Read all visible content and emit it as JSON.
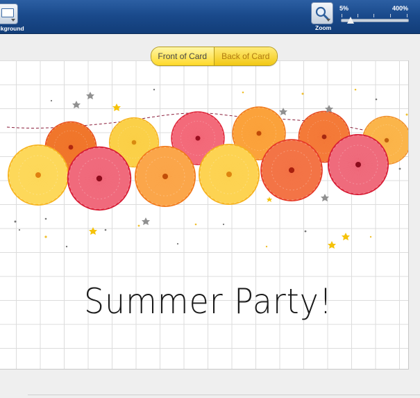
{
  "toolbar": {
    "background_label": "ckground",
    "zoom_label": "Zoom",
    "zoom_min": "5%",
    "zoom_max": "400%",
    "zoom_level_fraction": 0.15
  },
  "card_side": {
    "front_label": "Front of Card",
    "back_label": "Back of Card",
    "selected": "front"
  },
  "canvas": {
    "card_text": "Summer Party!"
  },
  "colors": {
    "toolbar_blue": "#1a4a8c",
    "toggle_yellow": "#ffd929",
    "grid": "#dcdcdc"
  },
  "icons": {
    "background": "background-frame-icon",
    "zoom": "magnifier-icon"
  }
}
